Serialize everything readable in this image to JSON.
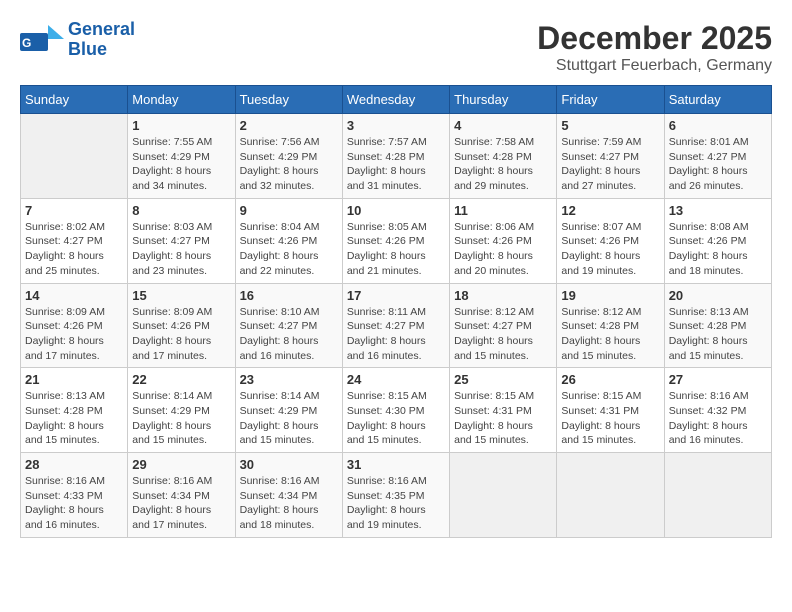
{
  "header": {
    "logo_line1": "General",
    "logo_line2": "Blue",
    "month": "December 2025",
    "location": "Stuttgart Feuerbach, Germany"
  },
  "weekdays": [
    "Sunday",
    "Monday",
    "Tuesday",
    "Wednesday",
    "Thursday",
    "Friday",
    "Saturday"
  ],
  "weeks": [
    [
      {
        "day": "",
        "info": ""
      },
      {
        "day": "1",
        "info": "Sunrise: 7:55 AM\nSunset: 4:29 PM\nDaylight: 8 hours\nand 34 minutes."
      },
      {
        "day": "2",
        "info": "Sunrise: 7:56 AM\nSunset: 4:29 PM\nDaylight: 8 hours\nand 32 minutes."
      },
      {
        "day": "3",
        "info": "Sunrise: 7:57 AM\nSunset: 4:28 PM\nDaylight: 8 hours\nand 31 minutes."
      },
      {
        "day": "4",
        "info": "Sunrise: 7:58 AM\nSunset: 4:28 PM\nDaylight: 8 hours\nand 29 minutes."
      },
      {
        "day": "5",
        "info": "Sunrise: 7:59 AM\nSunset: 4:27 PM\nDaylight: 8 hours\nand 27 minutes."
      },
      {
        "day": "6",
        "info": "Sunrise: 8:01 AM\nSunset: 4:27 PM\nDaylight: 8 hours\nand 26 minutes."
      }
    ],
    [
      {
        "day": "7",
        "info": "Sunrise: 8:02 AM\nSunset: 4:27 PM\nDaylight: 8 hours\nand 25 minutes."
      },
      {
        "day": "8",
        "info": "Sunrise: 8:03 AM\nSunset: 4:27 PM\nDaylight: 8 hours\nand 23 minutes."
      },
      {
        "day": "9",
        "info": "Sunrise: 8:04 AM\nSunset: 4:26 PM\nDaylight: 8 hours\nand 22 minutes."
      },
      {
        "day": "10",
        "info": "Sunrise: 8:05 AM\nSunset: 4:26 PM\nDaylight: 8 hours\nand 21 minutes."
      },
      {
        "day": "11",
        "info": "Sunrise: 8:06 AM\nSunset: 4:26 PM\nDaylight: 8 hours\nand 20 minutes."
      },
      {
        "day": "12",
        "info": "Sunrise: 8:07 AM\nSunset: 4:26 PM\nDaylight: 8 hours\nand 19 minutes."
      },
      {
        "day": "13",
        "info": "Sunrise: 8:08 AM\nSunset: 4:26 PM\nDaylight: 8 hours\nand 18 minutes."
      }
    ],
    [
      {
        "day": "14",
        "info": "Sunrise: 8:09 AM\nSunset: 4:26 PM\nDaylight: 8 hours\nand 17 minutes."
      },
      {
        "day": "15",
        "info": "Sunrise: 8:09 AM\nSunset: 4:26 PM\nDaylight: 8 hours\nand 17 minutes."
      },
      {
        "day": "16",
        "info": "Sunrise: 8:10 AM\nSunset: 4:27 PM\nDaylight: 8 hours\nand 16 minutes."
      },
      {
        "day": "17",
        "info": "Sunrise: 8:11 AM\nSunset: 4:27 PM\nDaylight: 8 hours\nand 16 minutes."
      },
      {
        "day": "18",
        "info": "Sunrise: 8:12 AM\nSunset: 4:27 PM\nDaylight: 8 hours\nand 15 minutes."
      },
      {
        "day": "19",
        "info": "Sunrise: 8:12 AM\nSunset: 4:28 PM\nDaylight: 8 hours\nand 15 minutes."
      },
      {
        "day": "20",
        "info": "Sunrise: 8:13 AM\nSunset: 4:28 PM\nDaylight: 8 hours\nand 15 minutes."
      }
    ],
    [
      {
        "day": "21",
        "info": "Sunrise: 8:13 AM\nSunset: 4:28 PM\nDaylight: 8 hours\nand 15 minutes."
      },
      {
        "day": "22",
        "info": "Sunrise: 8:14 AM\nSunset: 4:29 PM\nDaylight: 8 hours\nand 15 minutes."
      },
      {
        "day": "23",
        "info": "Sunrise: 8:14 AM\nSunset: 4:29 PM\nDaylight: 8 hours\nand 15 minutes."
      },
      {
        "day": "24",
        "info": "Sunrise: 8:15 AM\nSunset: 4:30 PM\nDaylight: 8 hours\nand 15 minutes."
      },
      {
        "day": "25",
        "info": "Sunrise: 8:15 AM\nSunset: 4:31 PM\nDaylight: 8 hours\nand 15 minutes."
      },
      {
        "day": "26",
        "info": "Sunrise: 8:15 AM\nSunset: 4:31 PM\nDaylight: 8 hours\nand 15 minutes."
      },
      {
        "day": "27",
        "info": "Sunrise: 8:16 AM\nSunset: 4:32 PM\nDaylight: 8 hours\nand 16 minutes."
      }
    ],
    [
      {
        "day": "28",
        "info": "Sunrise: 8:16 AM\nSunset: 4:33 PM\nDaylight: 8 hours\nand 16 minutes."
      },
      {
        "day": "29",
        "info": "Sunrise: 8:16 AM\nSunset: 4:34 PM\nDaylight: 8 hours\nand 17 minutes."
      },
      {
        "day": "30",
        "info": "Sunrise: 8:16 AM\nSunset: 4:34 PM\nDaylight: 8 hours\nand 18 minutes."
      },
      {
        "day": "31",
        "info": "Sunrise: 8:16 AM\nSunset: 4:35 PM\nDaylight: 8 hours\nand 19 minutes."
      },
      {
        "day": "",
        "info": ""
      },
      {
        "day": "",
        "info": ""
      },
      {
        "day": "",
        "info": ""
      }
    ]
  ]
}
